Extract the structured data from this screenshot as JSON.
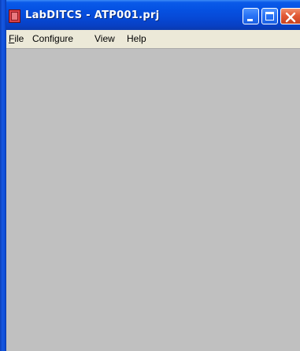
{
  "window": {
    "title": "LabDITCS - ATP001.prj"
  },
  "menubar": {
    "items": [
      {
        "accel": "F",
        "rest": "ile"
      },
      {
        "accel": "",
        "rest": "Configure"
      },
      {
        "accel": "",
        "rest": "View"
      },
      {
        "accel": "",
        "rest": "Help"
      }
    ]
  },
  "colors": {
    "titlebar": "#0552e3",
    "menubar": "#ece9d8",
    "client": "#c0c0c0",
    "close_button": "#e25a36"
  }
}
